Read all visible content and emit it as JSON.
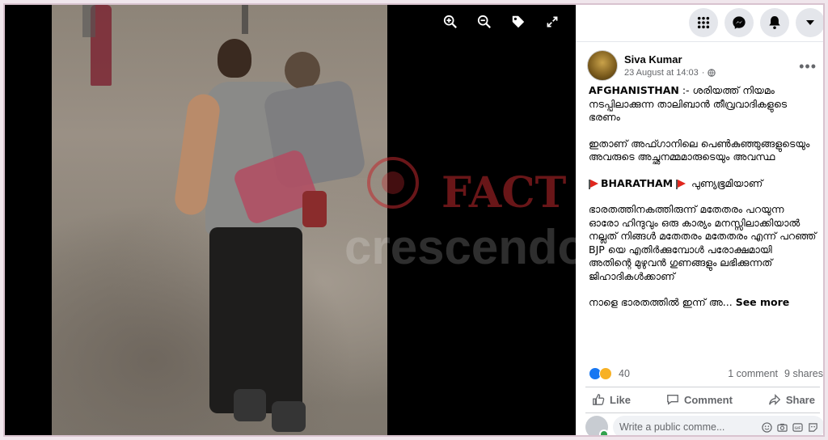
{
  "post": {
    "author": "Siva Kumar",
    "date": "23 August at 14:03",
    "visibility_icon": "globe-icon",
    "text": {
      "p1_bold": "AFGHANISTHAN",
      "p1_rest": " :- ശരിയത്ത് നിയമം നടപ്പിലാക്കുന്ന താലിബാൻ തീവ്രവാദികളുടെ ഭരണം",
      "p2": "ഇതാണ് അഫ്ഗാനിലെ പെൺകുഞ്ഞുങ്ങളുടെയും അവരുടെ അച്ഛനമ്മമാരുടെയും അവസ്ഥ",
      "p3_bold": "BHARATHAM",
      "p3_rest": " പുണ്യഭൂമിയാണ്",
      "p4": "ഭാരതത്തിനകത്തിരുന്ന് മതേതരം പറയുന്ന ഓരോ ഹിന്ദുവും ഒരു കാര്യം മനസ്സിലാക്കിയാൽ നല്ലത് നിങ്ങൾ മതേതരം മതേതരം എന്ന് പറഞ്ഞ് BJP യെ എതിർക്കുമ്പോൾ പരോക്ഷമായി അതിന്റെ മുഴുവൻ ഗുണങ്ങളും ലഭിക്കുന്നത് ജിഹാദികൾക്കാണ്",
      "p5": "നാളെ ഭാരതത്തിൽ ഇന്ന് അ...",
      "see_more": "See more"
    },
    "reaction_count": "40",
    "comments": "1 comment",
    "shares": "9 shares"
  },
  "actions": {
    "like": "Like",
    "comment": "Comment",
    "share": "Share"
  },
  "comment_box": {
    "placeholder": "Write a public comme..."
  },
  "watermark_text": {
    "top": "FACT",
    "bottom": "crescendo"
  },
  "colors": {
    "like_blue": "#1877f2",
    "flag_red": "#e0261d",
    "watermark_red": "#c0282d"
  }
}
